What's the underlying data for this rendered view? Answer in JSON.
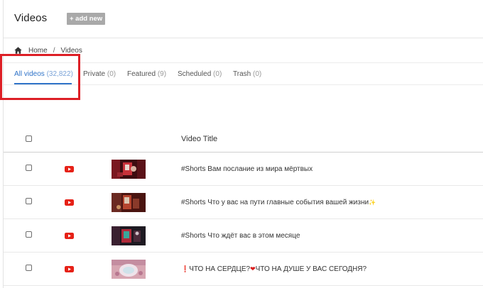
{
  "header": {
    "title": "Videos",
    "add_new_label": "+ add new"
  },
  "breadcrumb": {
    "home": "Home",
    "separator": "/",
    "current": "Videos"
  },
  "tabs": [
    {
      "label": "All videos",
      "count": "(32,822)",
      "active": true
    },
    {
      "label": "Private",
      "count": "(0)",
      "active": false
    },
    {
      "label": "Featured",
      "count": "(9)",
      "active": false
    },
    {
      "label": "Scheduled",
      "count": "(0)",
      "active": false
    },
    {
      "label": "Trash",
      "count": "(0)",
      "active": false
    }
  ],
  "table": {
    "columns": {
      "title": "Video Title"
    },
    "rows": [
      {
        "source_icon": "youtube-icon",
        "title": "#Shorts Вам послание из мира мёртвых"
      },
      {
        "source_icon": "youtube-icon",
        "title": "#Shorts Что у вас на пути главные события вашей жизни",
        "title_suffix": "✨"
      },
      {
        "source_icon": "youtube-icon",
        "title": "#Shorts Что ждёт вас в этом месяце"
      },
      {
        "source_icon": "youtube-icon",
        "title_prefix": "❗",
        "title": "ЧТО НА СЕРДЦЕ?",
        "title_heart": "❤",
        "title_after": "ЧТО НА ДУШЕ У ВАС СЕГОДНЯ?"
      }
    ]
  },
  "colors": {
    "accent": "#2f73c8",
    "highlight": "#dd1f26",
    "youtube": "#e62117",
    "add_new_bg": "#a9a9a9"
  }
}
